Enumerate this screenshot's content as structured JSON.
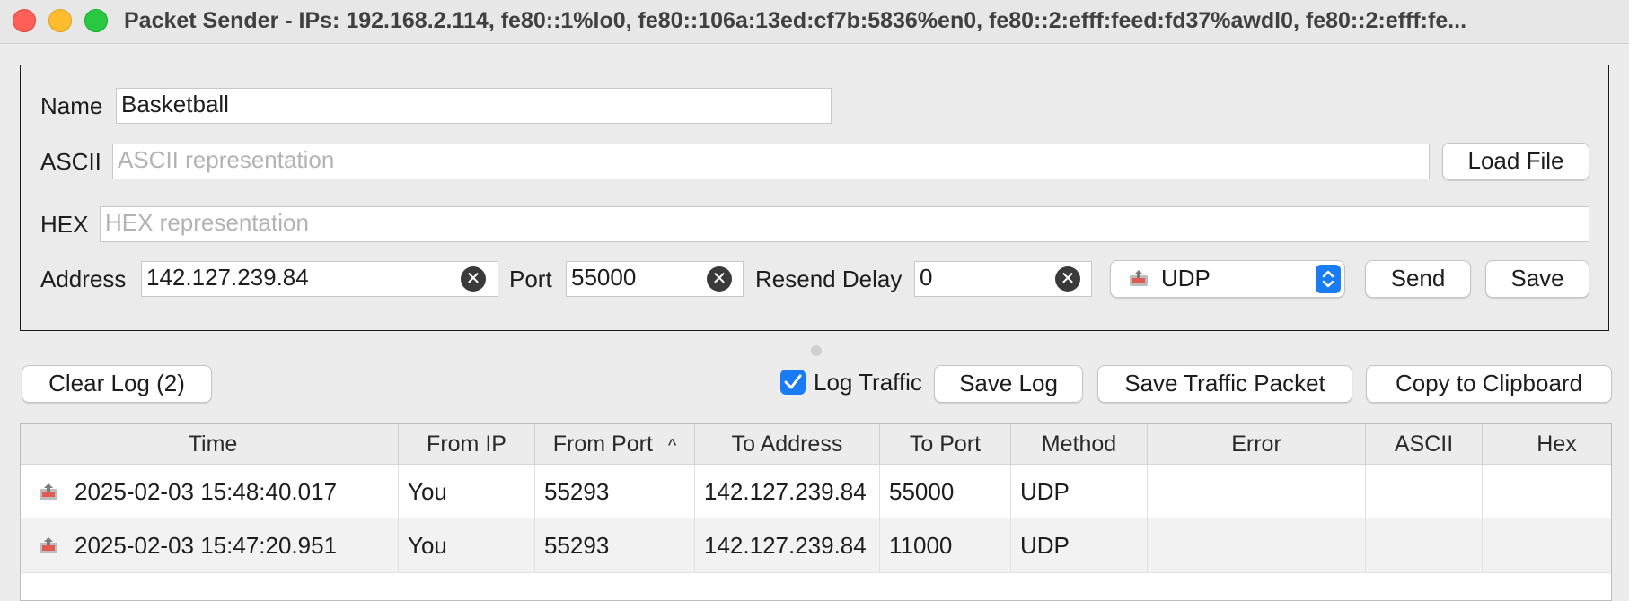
{
  "window": {
    "title": "Packet Sender - IPs: 192.168.2.114, fe80::1%lo0, fe80::106a:13ed:cf7b:5836%en0, fe80::2:efff:feed:fd37%awdl0, fe80::2:efff:fe..."
  },
  "packet": {
    "name_label": "Name",
    "name_value": "Basketball",
    "ascii_label": "ASCII",
    "ascii_placeholder": "ASCII representation",
    "load_file_label": "Load File",
    "hex_label": "HEX",
    "hex_placeholder": "HEX representation",
    "address_label": "Address",
    "address_value": "142.127.239.84",
    "port_label": "Port",
    "port_value": "55000",
    "resend_label": "Resend Delay",
    "resend_value": "0",
    "protocol_value": "UDP",
    "send_label": "Send",
    "save_label": "Save"
  },
  "log_toolbar": {
    "clear_log_label": "Clear Log (2)",
    "log_traffic_label": "Log Traffic",
    "log_traffic_checked": true,
    "save_log_label": "Save Log",
    "save_traffic_label": "Save Traffic Packet",
    "copy_label": "Copy to Clipboard"
  },
  "table": {
    "columns": [
      "Time",
      "From IP",
      "From Port",
      "To Address",
      "To Port",
      "Method",
      "Error",
      "ASCII",
      "Hex"
    ],
    "sort_indicator": "^",
    "rows": [
      {
        "time": "2025-02-03 15:48:40.017",
        "from_ip": "You",
        "from_port": "55293",
        "to_address": "142.127.239.84",
        "to_port": "55000",
        "method": "UDP",
        "error": "",
        "ascii": "",
        "hex": ""
      },
      {
        "time": "2025-02-03 15:47:20.951",
        "from_ip": "You",
        "from_port": "55293",
        "to_address": "142.127.239.84",
        "to_port": "11000",
        "method": "UDP",
        "error": "",
        "ascii": "",
        "hex": ""
      }
    ]
  },
  "colors": {
    "accent": "#1a7cf5",
    "close": "#fe5f57",
    "minimize": "#febc2e",
    "zoom": "#28c840"
  },
  "icons": {
    "row": "packet-sent-icon",
    "protocol": "udp-protocol-icon",
    "clear": "clear-field-icon"
  }
}
